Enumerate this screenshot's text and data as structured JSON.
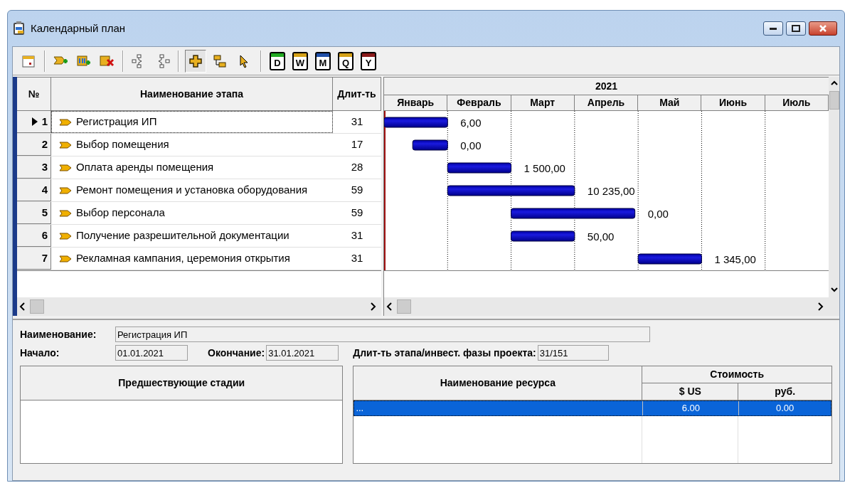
{
  "window": {
    "title": "Календарный план"
  },
  "toolbar": {
    "mode_tools": [
      {
        "selected": true
      },
      {
        "selected": false
      },
      {
        "selected": false
      }
    ],
    "scale_buttons": [
      {
        "label": "D",
        "color": "#22aa22"
      },
      {
        "label": "W",
        "color": "#d4a017"
      },
      {
        "label": "M",
        "color": "#1f4fa8"
      },
      {
        "label": "Q",
        "color": "#d4a017"
      },
      {
        "label": "Y",
        "color": "#8b1a1a"
      }
    ]
  },
  "table": {
    "columns": [
      "№",
      "Наименование этапа",
      "Длит-ть"
    ],
    "rows": [
      {
        "number": "1",
        "name": "Регистрация ИП",
        "duration": "31",
        "selected": true
      },
      {
        "number": "2",
        "name": "Выбор помещения",
        "duration": "17",
        "selected": false
      },
      {
        "number": "3",
        "name": "Оплата аренды помещения",
        "duration": "28",
        "selected": false
      },
      {
        "number": "4",
        "name": "Ремонт помещения и установка оборудования",
        "duration": "59",
        "selected": false
      },
      {
        "number": "5",
        "name": "Выбор персонала",
        "duration": "59",
        "selected": false
      },
      {
        "number": "6",
        "name": "Получение разрешительной документации",
        "duration": "31",
        "selected": false
      },
      {
        "number": "7",
        "name": "Рекламная кампания, церемония открытия",
        "duration": "31",
        "selected": false
      }
    ]
  },
  "gantt": {
    "year": "2021",
    "months": [
      "Январь",
      "Февраль",
      "Март",
      "Апрель",
      "Май",
      "Июнь",
      "Июль"
    ],
    "bar_labels": [
      "6,00",
      "0,00",
      "1 500,00",
      "10 235,00",
      "0,00",
      "50,00",
      "1 345,00"
    ]
  },
  "details": {
    "name_label": "Наименование:",
    "name_value": "Регистрация ИП",
    "start_label": "Начало:",
    "start_value": "01.01.2021",
    "end_label": "Окончание:",
    "end_value": "31.01.2021",
    "duration_label": "Длит-ть этапа/инвест. фазы проекта:",
    "duration_value": "31/151"
  },
  "predecessors": {
    "title": "Предшествующие стадии"
  },
  "resources": {
    "name_column": "Наименование ресурса",
    "cost_group": "Стоимость",
    "usd_column": "$ US",
    "rub_column": "руб.",
    "rows": [
      {
        "name": "...",
        "usd": "6.00",
        "rub": "0.00",
        "selected": true
      }
    ]
  }
}
